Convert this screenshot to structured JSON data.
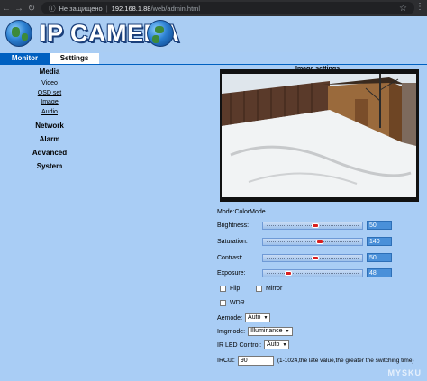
{
  "browser": {
    "security_label": "Не защищено",
    "url_host": "192.168.1.88",
    "url_path": "/web/admin.html"
  },
  "banner": {
    "logo_text": "IP CAMERA"
  },
  "tabs": [
    {
      "label": "Monitor",
      "active": false
    },
    {
      "label": "Settings",
      "active": true
    }
  ],
  "sidebar": {
    "groups": [
      {
        "label": "Media",
        "items": [
          "Video",
          "OSD set",
          "Image",
          "Audio"
        ]
      },
      {
        "label": "Network",
        "items": []
      },
      {
        "label": "Alarm",
        "items": []
      },
      {
        "label": "Advanced",
        "items": []
      },
      {
        "label": "System",
        "items": []
      }
    ]
  },
  "main": {
    "title": "Image settings",
    "mode_label": "Mode:ColorMode",
    "sliders": [
      {
        "label": "Brightness:",
        "value": "50",
        "level": 0.5
      },
      {
        "label": "Saturation:",
        "value": "140",
        "level": 0.55
      },
      {
        "label": "Contrast:",
        "value": "50",
        "level": 0.5
      },
      {
        "label": "Exposure:",
        "value": "48",
        "level": 0.2
      }
    ],
    "checkboxes": {
      "flip": "Flip",
      "mirror": "Mirror",
      "wdr": "WDR"
    },
    "aemode": {
      "label": "Aemode:",
      "value": "Auto"
    },
    "imgmode": {
      "label": "Imgmode:",
      "value": "Illuminance"
    },
    "ir_led": {
      "label": "IR LED Control:",
      "value": "Auto"
    },
    "ircut": {
      "label": "IRCut:",
      "value": "90",
      "hint": "(1-1024,the late value,the greater the switching time)"
    }
  },
  "watermark": "MYSKU",
  "colors": {
    "tab_active_bg": "#ffffff",
    "tab_inactive_bg": "#0060c0",
    "page_bg": "#a9cdf5",
    "slider_thumb": "#d82020"
  }
}
